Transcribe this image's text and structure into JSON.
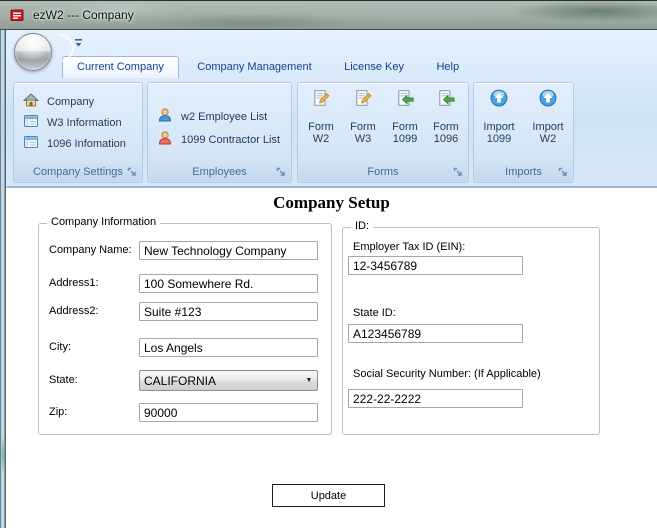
{
  "window": {
    "title": "ezW2 --- Company"
  },
  "colors": {
    "ribbon_label": "#1f3d60",
    "group_caption": "#3e6d9e",
    "tab_label": "#15428b",
    "ribbon_background": "#d7e7f8",
    "app_icon_red": "#cf1a1a"
  },
  "tabs": [
    {
      "label": "Current Company",
      "selected": true
    },
    {
      "label": "Company Management",
      "selected": false
    },
    {
      "label": "License Key",
      "selected": false
    },
    {
      "label": "Help",
      "selected": false
    }
  ],
  "ribbon": {
    "groups": [
      {
        "caption": "Company Settings",
        "items": [
          {
            "label": "Company",
            "icon": "home-icon"
          },
          {
            "label": "W3 Information",
            "icon": "form-table-icon"
          },
          {
            "label": "1096 Infomation",
            "icon": "form-table-icon"
          }
        ]
      },
      {
        "caption": "Employees",
        "items": [
          {
            "label": "w2 Employee List",
            "icon": "person-blue-icon"
          },
          {
            "label": "1099 Contractor List",
            "icon": "person-red-icon"
          }
        ]
      },
      {
        "caption": "Forms",
        "items": [
          {
            "line1": "Form",
            "line2": "W2",
            "icon": "form-edit-icon"
          },
          {
            "line1": "Form",
            "line2": "W3",
            "icon": "form-edit-icon"
          },
          {
            "line1": "Form",
            "line2": "1099",
            "icon": "form-export-icon"
          },
          {
            "line1": "Form",
            "line2": "1096",
            "icon": "form-export-icon"
          }
        ]
      },
      {
        "caption": "Imports",
        "items": [
          {
            "line1": "Import",
            "line2": "1099",
            "icon": "import-icon"
          },
          {
            "line1": "Import",
            "line2": "W2",
            "icon": "import-icon"
          }
        ]
      }
    ]
  },
  "main": {
    "title": "Company Setup",
    "company_info": {
      "caption": "Company Information",
      "company_name": {
        "label": "Company Name:",
        "value": "New Technology Company"
      },
      "address1": {
        "label": "Address1:",
        "value": "100 Somewhere Rd."
      },
      "address2": {
        "label": "Address2:",
        "value": "Suite #123"
      },
      "city": {
        "label": "City:",
        "value": "Los Angels"
      },
      "state": {
        "label": "State:",
        "value": "CALIFORNIA"
      },
      "zip": {
        "label": "Zip:",
        "value": "90000"
      }
    },
    "ids": {
      "caption": "ID:",
      "ein": {
        "label": "Employer Tax ID (EIN):",
        "value": "12-3456789"
      },
      "state_id": {
        "label": "State ID:",
        "value": "A123456789"
      },
      "ssn": {
        "label": "Social Security Number: (If Applicable)",
        "value": "222-22-2222"
      }
    },
    "update_button": "Update"
  }
}
